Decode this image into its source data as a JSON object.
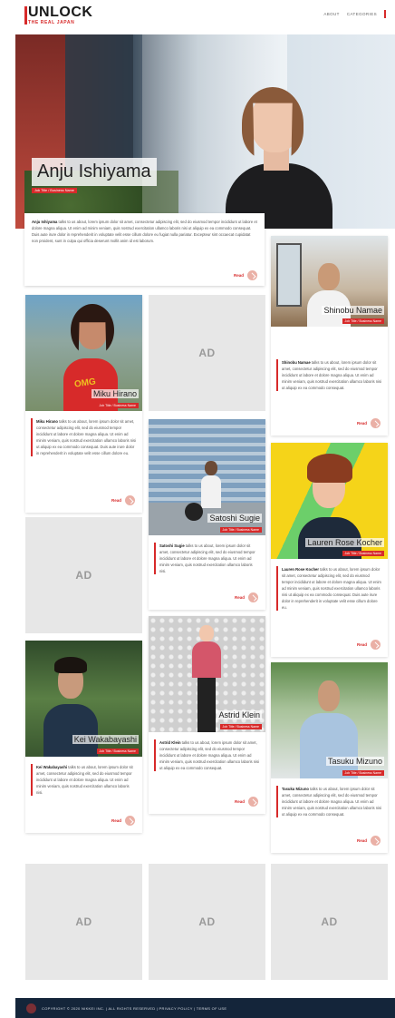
{
  "header": {
    "logo_text": "UNLOCK",
    "logo_subtitle": "THE REAL JAPAN",
    "nav": [
      "ABOUT",
      "CATEGORIES"
    ]
  },
  "hero": {
    "name": "Anju Ishiyama",
    "tag": "Job Title / Business Name",
    "text_name": "Anju Ishiyama",
    "text": " talks to us about, lorem ipsum dolor sit amet, consectetur adipiscing elit, sed do eiusmod tempor incididunt ut labore et dolore magna aliqua. Ut enim ad minim veniam, quis nostrud exercitation ullamco laboris nisi ut aliquip ex ea commodo consequat. Duis aute irure dolor in reprehenderit in voluptate velit esse cillum dolore eu fugiat nulla pariatur. Excepteur sint occaecat cupidatat non proident, sunt in culpa qui officia deserunt mollit anim id est laborum.",
    "read_label": "Read"
  },
  "profiles": [
    {
      "name": "Shinobu Namae",
      "tag": "Job Title / Business Name",
      "text": " talks to us about, lorem ipsum dolor sit amet, consectetur adipiscing elit, sed do eiusmod tempor incididunt ut labore et dolore magna aliqua. Ut enim ad minim veniam, quis nostrud exercitation ullamco laboris nisi ut aliquip ex ea commodo consequat.",
      "read_label": "Read"
    },
    {
      "name": "Miku Hirano",
      "tag": "Job Title / Business Name",
      "text": " talks to us about, lorem ipsum dolor sit amet, consectetur adipiscing elit, sed do eiusmod tempor incididunt ut labore et dolore magna aliqua. Ut enim ad minim veniam, quis nostrud exercitation ullamco laboris nisi ut aliquip ex ea commodo consequat. Duis aute irure dolor in reprehenderit in voluptate velit esse cillum dolore eu.",
      "read_label": "Read"
    },
    {
      "name": "Satoshi Sugie",
      "tag": "Job Title / Business Name",
      "text": " talks to us about, lorem ipsum dolor sit amet, consectetur adipiscing elit, sed do eiusmod tempor incididunt ut labore et dolore magna aliqua. Ut enim ad minim veniam, quis nostrud exercitation ullamco laboris nisi.",
      "read_label": "Read"
    },
    {
      "name": "Lauren Rose Kocher",
      "tag": "Job Title / Business Name",
      "text": " talks to us about, lorem ipsum dolor sit amet, consectetur adipiscing elit, sed do eiusmod tempor incididunt ut labore et dolore magna aliqua. Ut enim ad minim veniam, quis nostrud exercitation ullamco laboris nisi ut aliquip ex ea commodo consequat. Duis aute irure dolor in reprehenderit in voluptate velit esse cillum dolore eu.",
      "read_label": "Read"
    },
    {
      "name": "Kei Wakabayashi",
      "tag": "Job Title / Business Name",
      "text": " talks to us about, lorem ipsum dolor sit amet, consectetur adipiscing elit, sed do eiusmod tempor incididunt ut labore et dolore magna aliqua. Ut enim ad minim veniam, quis nostrud exercitation ullamco laboris nisi.",
      "read_label": "Read"
    },
    {
      "name": "Astrid Klein",
      "tag": "Job Title / Business Name",
      "text": " talks to us about, lorem ipsum dolor sit amet, consectetur adipiscing elit, sed do eiusmod tempor incididunt ut labore et dolore magna aliqua. Ut enim ad minim veniam, quis nostrud exercitation ullamco laboris nisi ut aliquip ex ea commodo consequat.",
      "read_label": "Read"
    },
    {
      "name": "Tasuku Mizuno",
      "tag": "Job Title / Business Name",
      "text": " talks to us about, lorem ipsum dolor sit amet, consectetur adipiscing elit, sed do eiusmod tempor incididunt ut labore et dolore magna aliqua. Ut enim ad minim veniam, quis nostrud exercitation ullamco laboris nisi ut aliquip ex ea commodo consequat.",
      "read_label": "Read"
    }
  ],
  "ad_label": "AD",
  "footer": {
    "text": "COPYRIGHT © 2020 NIKKEI INC.  |  ALL RIGHTS RESERVED  |  PRIVACY POLICY  |  TERMS OF USE"
  },
  "colors": {
    "accent": "#d72a2a",
    "footer_bg": "#14253a",
    "ad_bg": "#e7e7e7"
  }
}
